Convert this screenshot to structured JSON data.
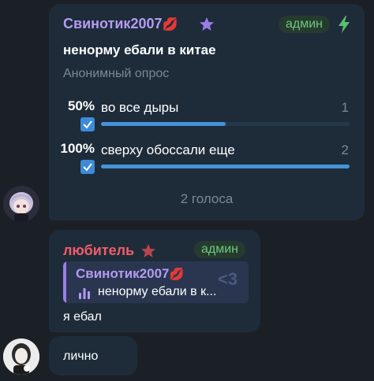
{
  "poll_message": {
    "sender": "Свинотик2007",
    "sender_emoji": "💋",
    "badge": "админ",
    "question": "ненорму ебали в китае",
    "poll_type": "Анонимный опрос",
    "options": [
      {
        "percent": "50%",
        "text": "во все дыры",
        "count": "1",
        "fraction": 0.5
      },
      {
        "percent": "100%",
        "text": "сверху обоссали еще",
        "count": "2",
        "fraction": 1.0
      }
    ],
    "votes": "2 голоса"
  },
  "reply_message": {
    "sender": "любитель",
    "badge": "админ",
    "quote_sender": "Свинотик2007",
    "quote_text": "ненорму ебали в к...",
    "text": "я ебал"
  },
  "third_message": {
    "text": "лично"
  },
  "icons": {
    "star_purple": "star-icon",
    "star_red": "star-icon",
    "bolt": "lightning-icon",
    "check": "checkbox-icon",
    "poll": "poll-icon",
    "heart_outline": "heart-icon"
  },
  "colors": {
    "background": "#1a2026",
    "bubble": "#1e2c3a",
    "sender_purple": "#b49bf0",
    "sender_red": "#f25c6a",
    "admin_green": "#6ec97a",
    "accent_blue": "#4593d8"
  }
}
